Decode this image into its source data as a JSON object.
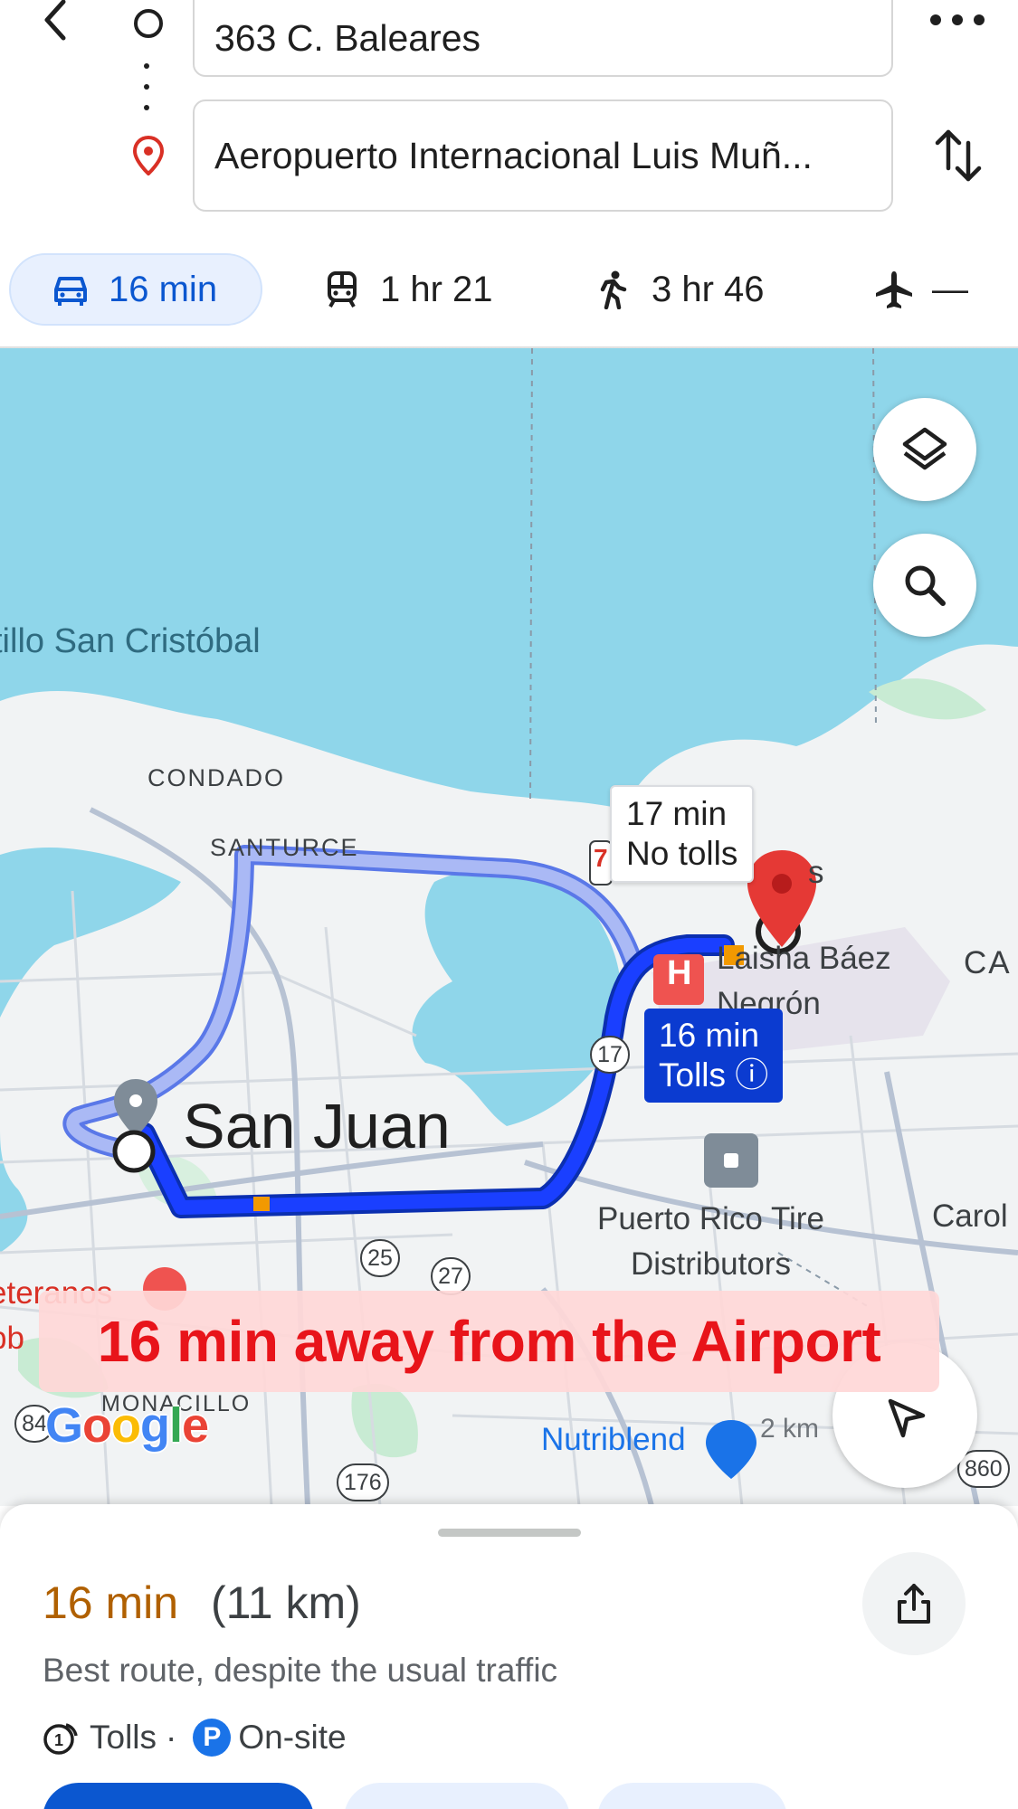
{
  "route": {
    "origin": "363 C. Baleares",
    "destination": "Aeropuerto Internacional Luis Muñ..."
  },
  "modes": [
    {
      "label": "16 min",
      "icon": "car-icon"
    },
    {
      "label": "1 hr 21",
      "icon": "train-icon"
    },
    {
      "label": "3 hr 46",
      "icon": "walking-icon"
    },
    {
      "label": "—",
      "icon": "airplane-icon"
    }
  ],
  "map": {
    "labels": {
      "castillo": "tillo San Cristóbal",
      "condado": "CONDADO",
      "santurce": "SANTURCE",
      "san_juan": "San Juan",
      "laisha_line1": "Laisha Báez",
      "laisha_line2": "Negrón",
      "ca": "CA",
      "carol": "Carol",
      "pr_tire_line1": "Puerto Rico Tire",
      "pr_tire_line2": "Distributors",
      "veteranos_line1": "eteranos",
      "veteranos_line2": "bb",
      "monacillo": "MONACILLO",
      "nutriblend": "Nutriblend",
      "s": "s",
      "km": "2 km"
    },
    "shields": {
      "r17": "17",
      "r25": "25",
      "r27": "27",
      "r176": "176",
      "r84": "84",
      "r860": "860",
      "r7": "7"
    },
    "alt_route": {
      "time": "17 min",
      "note": "No tolls"
    },
    "main_route": {
      "time": "16 min",
      "note": "Tolls ⓘ"
    },
    "hospital_marker": "H",
    "logo": "Google",
    "overlay_text": "16 min away from the Airport",
    "colors": {
      "water": "#8fd6ea",
      "route_main": "#1a3fff",
      "route_alt": "#aab9f5"
    }
  },
  "sheet": {
    "eta": "16 min",
    "distance": "(11 km)",
    "summary": "Best route, despite the usual traffic",
    "tolls": "Tolls",
    "separator": "·",
    "parking_badge": "P",
    "parking": "On-site"
  }
}
